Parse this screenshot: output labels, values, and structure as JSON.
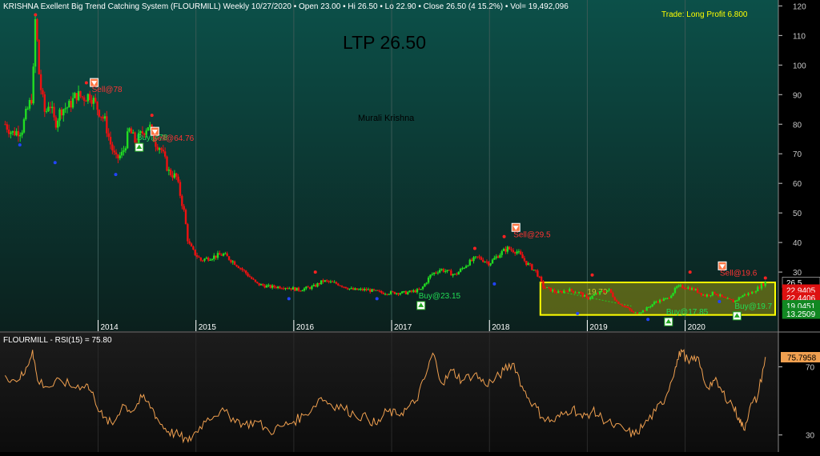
{
  "header": {
    "title": "KRISHNA Exellent Big Trend Catching System (FLOURMILL) Weekly  10/27/2020  •  Open 23.00  •  Hi 26.50  •  Lo 22.90  •  Close 26.50 (4 15.2%)  •  Vol= 19,492,096",
    "trade_status": "Trade: Long Profit   6.800",
    "ltp": "LTP 26.50",
    "author": "Murali Krishna"
  },
  "rsi_panel": {
    "title": "FLOURMILL - RSI(15) = 75.80",
    "value_tag": "75.7958"
  },
  "colors": {
    "up": "#22dd22",
    "down": "#ee1111",
    "rsi_line": "#f0a050",
    "axis_text": "#c8c8c8",
    "zone_border": "#ffff00",
    "header_text": "#ffffff",
    "trade_text": "#ffff00"
  },
  "chart_data": [
    {
      "type": "candlestick",
      "title": "KRISHNA Exellent Big Trend Catching System (FLOURMILL) Weekly",
      "ylim": [
        10,
        122
      ],
      "x_ticks": [
        {
          "label": "2014",
          "x": 2014.0
        },
        {
          "label": "2015",
          "x": 2015.0
        },
        {
          "label": "2016",
          "x": 2016.0
        },
        {
          "label": "2017",
          "x": 2017.0
        },
        {
          "label": "2018",
          "x": 2018.0
        },
        {
          "label": "2019",
          "x": 2019.0
        },
        {
          "label": "2020",
          "x": 2020.0
        }
      ],
      "y_ticks": [
        120,
        110,
        100,
        90,
        80,
        70,
        60,
        50,
        40,
        30
      ],
      "price_path": [
        [
          2013.05,
          80
        ],
        [
          2013.12,
          77
        ],
        [
          2013.22,
          78
        ],
        [
          2013.25,
          82
        ],
        [
          2013.33,
          90
        ],
        [
          2013.36,
          117
        ],
        [
          2013.4,
          95
        ],
        [
          2013.46,
          83
        ],
        [
          2013.5,
          88
        ],
        [
          2013.56,
          80
        ],
        [
          2013.62,
          85
        ],
        [
          2013.7,
          86
        ],
        [
          2013.78,
          90
        ],
        [
          2013.85,
          89
        ],
        [
          2013.92,
          90
        ],
        [
          2014.0,
          85
        ],
        [
          2014.07,
          81
        ],
        [
          2014.12,
          74
        ],
        [
          2014.18,
          68
        ],
        [
          2014.25,
          70
        ],
        [
          2014.32,
          78
        ],
        [
          2014.38,
          74
        ],
        [
          2014.45,
          77
        ],
        [
          2014.52,
          80
        ],
        [
          2014.58,
          74
        ],
        [
          2014.64,
          72
        ],
        [
          2014.72,
          64
        ],
        [
          2014.8,
          62
        ],
        [
          2014.88,
          50
        ],
        [
          2014.92,
          40
        ],
        [
          2014.97,
          37
        ],
        [
          2015.05,
          34
        ],
        [
          2015.15,
          35
        ],
        [
          2015.28,
          36
        ],
        [
          2015.4,
          33
        ],
        [
          2015.5,
          30
        ],
        [
          2015.62,
          26
        ],
        [
          2015.75,
          25
        ],
        [
          2015.9,
          25
        ],
        [
          2016.05,
          24
        ],
        [
          2016.2,
          25
        ],
        [
          2016.3,
          27
        ],
        [
          2016.45,
          26
        ],
        [
          2016.6,
          24
        ],
        [
          2016.75,
          24
        ],
        [
          2016.9,
          23
        ],
        [
          2017.05,
          23
        ],
        [
          2017.15,
          23
        ],
        [
          2017.3,
          24
        ],
        [
          2017.4,
          29
        ],
        [
          2017.5,
          31
        ],
        [
          2017.65,
          29
        ],
        [
          2017.78,
          33
        ],
        [
          2017.88,
          35
        ],
        [
          2018.0,
          33
        ],
        [
          2018.1,
          36
        ],
        [
          2018.18,
          38
        ],
        [
          2018.28,
          37
        ],
        [
          2018.38,
          33
        ],
        [
          2018.48,
          30
        ],
        [
          2018.55,
          25
        ],
        [
          2018.62,
          24
        ],
        [
          2018.7,
          23
        ],
        [
          2018.8,
          24
        ],
        [
          2018.92,
          23
        ],
        [
          2019.0,
          21
        ],
        [
          2019.12,
          23
        ],
        [
          2019.22,
          24
        ],
        [
          2019.3,
          20
        ],
        [
          2019.4,
          18
        ],
        [
          2019.48,
          16
        ],
        [
          2019.58,
          17
        ],
        [
          2019.7,
          20
        ],
        [
          2019.82,
          21
        ],
        [
          2019.92,
          25
        ],
        [
          2020.0,
          25
        ],
        [
          2020.1,
          24
        ],
        [
          2020.2,
          22
        ],
        [
          2020.3,
          23
        ],
        [
          2020.4,
          21
        ],
        [
          2020.5,
          20
        ],
        [
          2020.58,
          22
        ],
        [
          2020.68,
          23
        ],
        [
          2020.76,
          25
        ],
        [
          2020.82,
          26.5
        ]
      ],
      "signals": [
        {
          "label": "Sell@78",
          "x": 2013.96,
          "y": 89.5,
          "kind": "sell"
        },
        {
          "label": "Buy@78",
          "x": 2014.42,
          "y": 73,
          "kind": "buy"
        },
        {
          "label": "Sell@64.76",
          "x": 2014.58,
          "y": 73,
          "kind": "sell"
        },
        {
          "label": "Buy@23.15",
          "x": 2017.3,
          "y": 19.5,
          "kind": "buy"
        },
        {
          "label": "Sell@29.5",
          "x": 2018.27,
          "y": 40.5,
          "kind": "sell"
        },
        {
          "label": "Buy@17.85",
          "x": 2019.83,
          "y": 14,
          "kind": "buy"
        },
        {
          "label": "Sell@19.6",
          "x": 2020.38,
          "y": 27.5,
          "kind": "sell"
        },
        {
          "label": "Buy@19.7",
          "x": 2020.53,
          "y": 16,
          "kind": "buy"
        }
      ],
      "zone_labels": [
        "19.70"
      ],
      "zone": {
        "x0": 2018.52,
        "x1": 2020.92,
        "y0": 15.5,
        "y1": 26.5
      },
      "price_tags": [
        {
          "label": "26.5",
          "y": 26.5,
          "bg": "#000000",
          "fg": "#ffffff"
        },
        {
          "label": "22.9405",
          "y": 24.0,
          "bg": "#dd1111",
          "fg": "#ffffff"
        },
        {
          "label": "22.4406",
          "y": 21.3,
          "bg": "#dd1111",
          "fg": "#ffffff"
        },
        {
          "label": "19.0451",
          "y": 18.7,
          "bg": "#118822",
          "fg": "#ffffff"
        },
        {
          "label": "13.2509",
          "y": 16.0,
          "bg": "#118822",
          "fg": "#ffffff"
        }
      ]
    },
    {
      "type": "line",
      "title": "FLOURMILL - RSI(15) = 75.80",
      "ylim": [
        20,
        90
      ],
      "y_ticks": [
        70,
        30
      ],
      "series": [
        {
          "name": "RSI(15)",
          "points": [
            [
              2013.05,
              65
            ],
            [
              2013.15,
              62
            ],
            [
              2013.25,
              66
            ],
            [
              2013.33,
              80
            ],
            [
              2013.38,
              62
            ],
            [
              2013.5,
              58
            ],
            [
              2013.62,
              62
            ],
            [
              2013.75,
              58
            ],
            [
              2013.88,
              60
            ],
            [
              2013.96,
              52
            ],
            [
              2014.05,
              40
            ],
            [
              2014.15,
              36
            ],
            [
              2014.25,
              48
            ],
            [
              2014.35,
              44
            ],
            [
              2014.45,
              52
            ],
            [
              2014.55,
              46
            ],
            [
              2014.62,
              38
            ],
            [
              2014.72,
              32
            ],
            [
              2014.82,
              30
            ],
            [
              2014.92,
              26
            ],
            [
              2015.0,
              32
            ],
            [
              2015.12,
              40
            ],
            [
              2015.25,
              44
            ],
            [
              2015.38,
              40
            ],
            [
              2015.5,
              36
            ],
            [
              2015.62,
              38
            ],
            [
              2015.75,
              32
            ],
            [
              2015.88,
              35
            ],
            [
              2016.0,
              38
            ],
            [
              2016.12,
              42
            ],
            [
              2016.28,
              52
            ],
            [
              2016.38,
              48
            ],
            [
              2016.5,
              46
            ],
            [
              2016.62,
              42
            ],
            [
              2016.75,
              40
            ],
            [
              2016.85,
              36
            ],
            [
              2016.95,
              44
            ],
            [
              2017.05,
              42
            ],
            [
              2017.15,
              45
            ],
            [
              2017.25,
              50
            ],
            [
              2017.35,
              65
            ],
            [
              2017.42,
              78
            ],
            [
              2017.52,
              60
            ],
            [
              2017.62,
              68
            ],
            [
              2017.72,
              62
            ],
            [
              2017.85,
              66
            ],
            [
              2017.95,
              60
            ],
            [
              2018.05,
              62
            ],
            [
              2018.15,
              68
            ],
            [
              2018.25,
              72
            ],
            [
              2018.35,
              56
            ],
            [
              2018.45,
              48
            ],
            [
              2018.55,
              40
            ],
            [
              2018.65,
              38
            ],
            [
              2018.75,
              42
            ],
            [
              2018.85,
              46
            ],
            [
              2018.95,
              40
            ],
            [
              2019.05,
              44
            ],
            [
              2019.15,
              40
            ],
            [
              2019.25,
              36
            ],
            [
              2019.38,
              33
            ],
            [
              2019.48,
              30
            ],
            [
              2019.58,
              36
            ],
            [
              2019.7,
              44
            ],
            [
              2019.8,
              52
            ],
            [
              2019.9,
              70
            ],
            [
              2019.96,
              80
            ],
            [
              2020.04,
              72
            ],
            [
              2020.12,
              76
            ],
            [
              2020.22,
              58
            ],
            [
              2020.3,
              62
            ],
            [
              2020.38,
              55
            ],
            [
              2020.48,
              48
            ],
            [
              2020.55,
              40
            ],
            [
              2020.6,
              33
            ],
            [
              2020.66,
              46
            ],
            [
              2020.74,
              52
            ],
            [
              2020.82,
              75.8
            ]
          ]
        }
      ]
    }
  ]
}
